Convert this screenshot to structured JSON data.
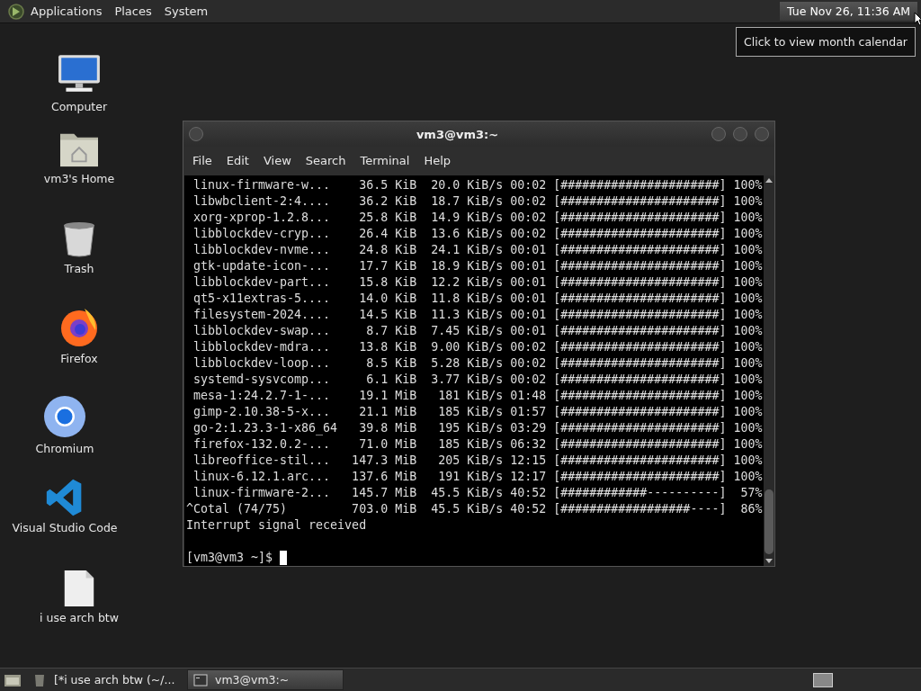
{
  "top_panel": {
    "menus": [
      "Applications",
      "Places",
      "System"
    ],
    "clock": "Tue Nov 26, 11:36 AM",
    "tooltip": "Click to view month calendar"
  },
  "desktop_icons": [
    {
      "kind": "computer",
      "label": "Computer"
    },
    {
      "kind": "home",
      "label": "vm3's Home"
    },
    {
      "kind": "trash",
      "label": "Trash"
    },
    {
      "kind": "firefox",
      "label": "Firefox"
    },
    {
      "kind": "chromium",
      "label": "Chromium"
    },
    {
      "kind": "vscode",
      "label": "Visual Studio Code"
    },
    {
      "kind": "file",
      "label": "i use arch btw"
    }
  ],
  "terminal": {
    "title": "vm3@vm3:~",
    "menu": [
      "File",
      "Edit",
      "View",
      "Search",
      "Terminal",
      "Help"
    ],
    "lines": [
      " linux-firmware-w...    36.5 KiB  20.0 KiB/s 00:02 [######################] 100%",
      " libwbclient-2:4....    36.2 KiB  18.7 KiB/s 00:02 [######################] 100%",
      " xorg-xprop-1.2.8...    25.8 KiB  14.9 KiB/s 00:02 [######################] 100%",
      " libblockdev-cryp...    26.4 KiB  13.6 KiB/s 00:02 [######################] 100%",
      " libblockdev-nvme...    24.8 KiB  24.1 KiB/s 00:01 [######################] 100%",
      " gtk-update-icon-...    17.7 KiB  18.9 KiB/s 00:01 [######################] 100%",
      " libblockdev-part...    15.8 KiB  12.2 KiB/s 00:01 [######################] 100%",
      " qt5-x11extras-5....    14.0 KiB  11.8 KiB/s 00:01 [######################] 100%",
      " filesystem-2024....    14.5 KiB  11.3 KiB/s 00:01 [######################] 100%",
      " libblockdev-swap...     8.7 KiB  7.45 KiB/s 00:01 [######################] 100%",
      " libblockdev-mdra...    13.8 KiB  9.00 KiB/s 00:02 [######################] 100%",
      " libblockdev-loop...     8.5 KiB  5.28 KiB/s 00:02 [######################] 100%",
      " systemd-sysvcomp...     6.1 KiB  3.77 KiB/s 00:02 [######################] 100%",
      " mesa-1:24.2.7-1-...    19.1 MiB   181 KiB/s 01:48 [######################] 100%",
      " gimp-2.10.38-5-x...    21.1 MiB   185 KiB/s 01:57 [######################] 100%",
      " go-2:1.23.3-1-x86_64   39.8 MiB   195 KiB/s 03:29 [######################] 100%",
      " firefox-132.0.2-...    71.0 MiB   185 KiB/s 06:32 [######################] 100%",
      " libreoffice-stil...   147.3 MiB   205 KiB/s 12:15 [######################] 100%",
      " linux-6.12.1.arc...   137.6 MiB   191 KiB/s 12:17 [######################] 100%",
      " linux-firmware-2...   145.7 MiB  45.5 KiB/s 40:52 [############----------]  57%",
      "^Cotal (74/75)         703.0 MiB  45.5 KiB/s 40:52 [##################----]  86%",
      "Interrupt signal received"
    ],
    "prompt": "[vm3@vm3 ~]$ "
  },
  "taskbar": {
    "items": [
      {
        "kind": "editor",
        "label": "[*i use arch btw (~/...",
        "selected": false
      },
      {
        "kind": "terminal",
        "label": "vm3@vm3:~",
        "selected": true
      }
    ]
  }
}
